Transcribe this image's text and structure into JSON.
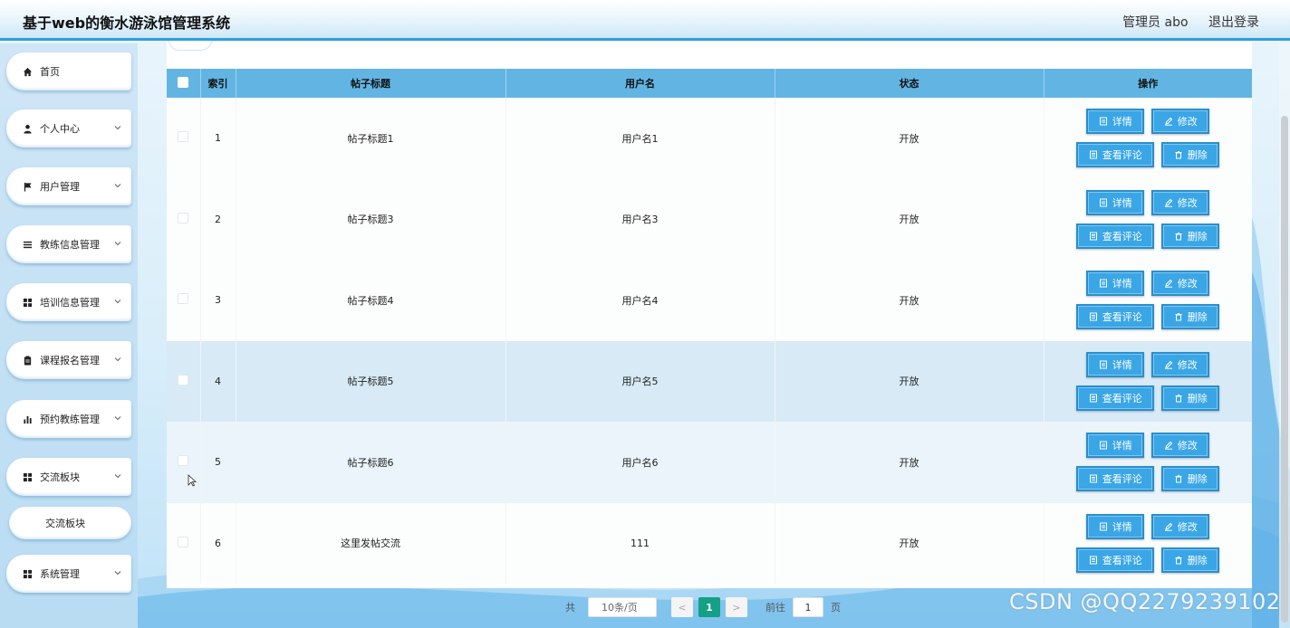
{
  "header": {
    "title": "基于web的衡水游泳馆管理系统",
    "user": "管理员 abo",
    "logout": "退出登录"
  },
  "sidebar": {
    "items": [
      {
        "label": "首页",
        "icon": "home-icon",
        "expandable": false
      },
      {
        "label": "个人中心",
        "icon": "person-icon",
        "expandable": true
      },
      {
        "label": "用户管理",
        "icon": "flag-icon",
        "expandable": true
      },
      {
        "label": "教练信息管理",
        "icon": "list-icon",
        "expandable": true
      },
      {
        "label": "培训信息管理",
        "icon": "grid-icon",
        "expandable": true
      },
      {
        "label": "课程报名管理",
        "icon": "clipboard-icon",
        "expandable": true
      },
      {
        "label": "预约教练管理",
        "icon": "bar-chart-icon",
        "expandable": true
      },
      {
        "label": "交流板块",
        "icon": "grid-icon",
        "expandable": true
      },
      {
        "label": "交流板块",
        "icon": "",
        "expandable": false,
        "submenu": true
      },
      {
        "label": "系统管理",
        "icon": "grid-icon",
        "expandable": true
      }
    ]
  },
  "table": {
    "columns": [
      "索引",
      "帖子标题",
      "用户名",
      "状态",
      "操作"
    ],
    "rows": [
      {
        "index": "1",
        "title": "帖子标题1",
        "user": "用户名1",
        "status": "开放",
        "style": "white"
      },
      {
        "index": "2",
        "title": "帖子标题3",
        "user": "用户名3",
        "status": "开放",
        "style": "white"
      },
      {
        "index": "3",
        "title": "帖子标题4",
        "user": "用户名4",
        "status": "开放",
        "style": "white"
      },
      {
        "index": "4",
        "title": "帖子标题5",
        "user": "用户名5",
        "status": "开放",
        "style": "hl"
      },
      {
        "index": "5",
        "title": "帖子标题6",
        "user": "用户名6",
        "status": "开放",
        "style": "light"
      },
      {
        "index": "6",
        "title": "这里发帖交流",
        "user": "111",
        "status": "开放",
        "style": "white"
      }
    ],
    "actions": {
      "detail": "详情",
      "edit": "修改",
      "comments": "查看评论",
      "delete": "删除"
    }
  },
  "pagination": {
    "total_prefix": "共",
    "page_size": "10条/页",
    "prev": "<",
    "current_page": "1",
    "next": ">",
    "goto_label": "前往",
    "goto_value": "1",
    "page_suffix": "页"
  },
  "watermark": "CSDN @QQ2279239102",
  "colors": {
    "header_border": "#2f9ee0",
    "table_header": "#62b5e3",
    "button": "#3aa6e6",
    "pager_active": "#14a085",
    "highlight_row": "#d7eaf6"
  }
}
